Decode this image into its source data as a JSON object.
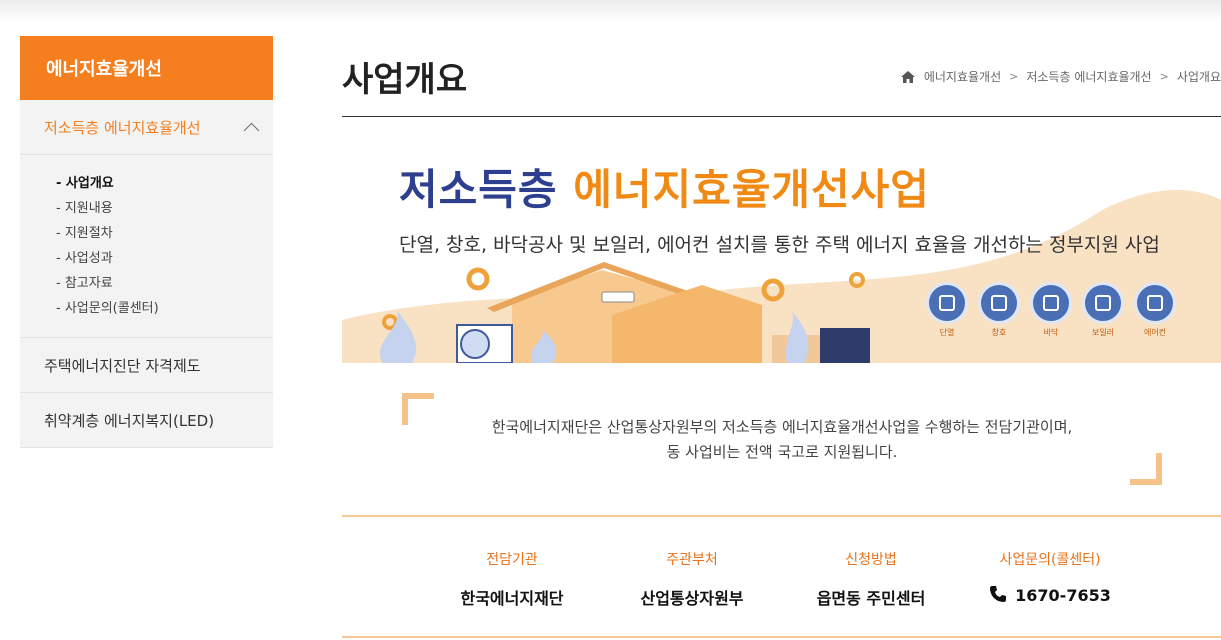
{
  "sidebar": {
    "heading": "에너지효율개선",
    "active_section": "저소득층 에너지효율개선",
    "sub_items": [
      "- 사업개요",
      "- 지원내용",
      "- 지원절차",
      "- 사업성과",
      "- 참고자료",
      "- 사업문의(콜센터)"
    ],
    "items": [
      "주택에너지진단 자격제도",
      "취약계층 에너지복지(LED)"
    ]
  },
  "page": {
    "title": "사업개요",
    "breadcrumb": [
      "에너지효율개선",
      "저소득층 에너지효율개선",
      "사업개요"
    ]
  },
  "banner": {
    "title_part1": "저소득층",
    "title_part2": "에너지효율개선사업",
    "subtitle": "단열, 창호, 바닥공사 및 보일러, 에어컨 설치를 통한 주택 에너지 효율을 개선하는 정부지원 사업",
    "icons": [
      {
        "name": "insulation-icon",
        "label": "단열"
      },
      {
        "name": "window-icon",
        "label": "창호"
      },
      {
        "name": "floor-icon",
        "label": "바닥"
      },
      {
        "name": "boiler-icon",
        "label": "보일러"
      },
      {
        "name": "aircon-icon",
        "label": "에어컨"
      }
    ]
  },
  "intro": {
    "line1": "한국에너지재단은 산업통상자원부의 저소득층 에너지효율개선사업을 수행하는 전담기관이며,",
    "line2": "동 사업비는 전액 국고로 지원됩니다."
  },
  "info": {
    "agency_label": "전담기관",
    "agency_value": "한국에너지재단",
    "ministry_label": "주관부처",
    "ministry_value": "산업통상자원부",
    "apply_label": "신청방법",
    "apply_value": "읍면동 주민센터",
    "callcenter_label": "사업문의(콜센터)",
    "callcenter_value": "1670-7653"
  },
  "colors": {
    "accent": "#f57f1f",
    "navy": "#2d3f8e",
    "sidebar_bg": "#f3f3f3"
  }
}
